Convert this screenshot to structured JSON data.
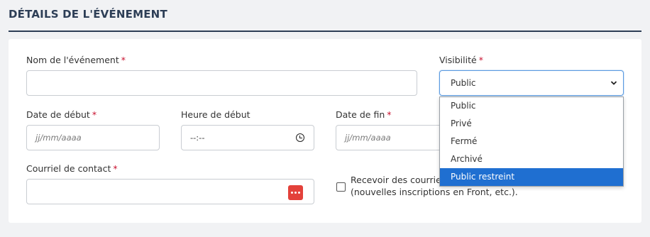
{
  "section": {
    "title": "DÉTAILS DE L'ÉVÉNEMENT"
  },
  "fields": {
    "event_name": {
      "label": "Nom de l'événement",
      "required": "*",
      "value": ""
    },
    "visibility": {
      "label": "Visibilité",
      "required": "*",
      "value": "Public",
      "options": [
        "Public",
        "Privé",
        "Fermé",
        "Archivé",
        "Public restreint"
      ],
      "highlighted": "Public restreint"
    },
    "start_date": {
      "label": "Date de début",
      "required": "*",
      "placeholder": "jj/mm/aaaa"
    },
    "start_time": {
      "label": "Heure de début",
      "value": "--:--"
    },
    "end_date": {
      "label": "Date de fin",
      "required": "*",
      "placeholder": "jj/mm/aaaa"
    },
    "contact_email": {
      "label": "Courriel de contact",
      "required": "*",
      "value": ""
    },
    "notify": {
      "line1": "Recevoir des courriels",
      "line2": "(nouvelles inscriptions en Front, etc.).",
      "checked": false
    }
  },
  "colors": {
    "accent": "#2d3e56",
    "required": "#c8102e",
    "selected_option": "#1f6fd1",
    "password_icon": "#e3413a"
  },
  "icons": {
    "time": "clock-icon",
    "select": "chevron-down-icon",
    "email": "password-manager-icon"
  }
}
